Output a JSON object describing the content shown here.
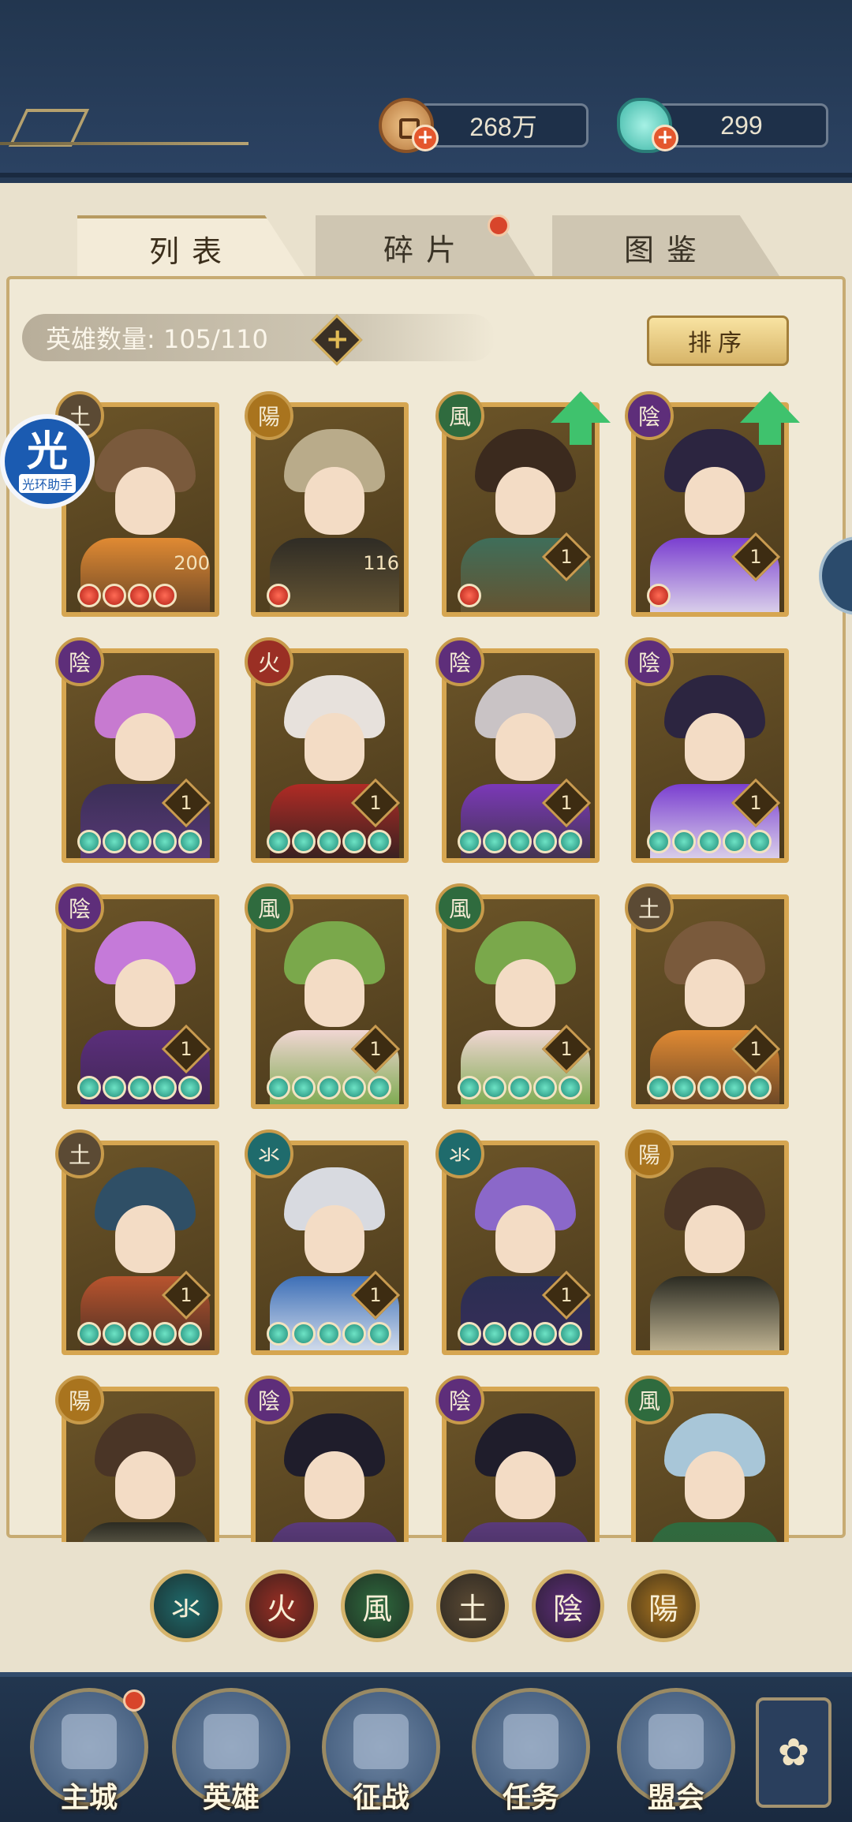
{
  "currency": {
    "coins": "268万",
    "gems": "299"
  },
  "tabs": [
    {
      "label": "列表",
      "active": true
    },
    {
      "label": "碎片",
      "active": false,
      "badge": true
    },
    {
      "label": "图鉴",
      "active": false
    }
  ],
  "hero_count": {
    "label": "英雄数量: 105/110"
  },
  "sort_button": "排序",
  "assist_badge": {
    "main": "光",
    "sub": "光环助手"
  },
  "elements": {
    "water": {
      "glyph": "氺",
      "color": "#1f6b6c"
    },
    "fire": {
      "glyph": "火",
      "color": "#9a2f24"
    },
    "wind": {
      "glyph": "風",
      "color": "#2f6b3e"
    },
    "earth": {
      "glyph": "土",
      "color": "#5b4a34"
    },
    "yin": {
      "glyph": "陰",
      "color": "#5e2e7a"
    },
    "yang": {
      "glyph": "陽",
      "color": "#a9741e"
    }
  },
  "heroes": [
    {
      "element": "earth",
      "level": "200",
      "stars": 4,
      "star_type": "red",
      "upgrade": false,
      "palette": [
        "#7a5a3c",
        "#e08a33",
        "#5a3d24"
      ]
    },
    {
      "element": "yang",
      "level": "116",
      "stars": 1,
      "star_type": "red",
      "upgrade": false,
      "palette": [
        "#b9ab8a",
        "#2f2c25",
        "#6c5a35"
      ]
    },
    {
      "element": "wind",
      "level": "1",
      "stars": 1,
      "star_type": "red",
      "upgrade": true,
      "palette": [
        "#3b2a1e",
        "#3f6e5a",
        "#6b4f2a"
      ]
    },
    {
      "element": "yin",
      "level": "1",
      "stars": 1,
      "star_type": "red",
      "upgrade": true,
      "palette": [
        "#2c2540",
        "#7a3fd0",
        "#e8e6ee"
      ]
    },
    {
      "element": "yin",
      "level": "1",
      "stars": 5,
      "star_type": "green",
      "upgrade": false,
      "palette": [
        "#c77ad0",
        "#3b2f57",
        "#5c3a7a"
      ]
    },
    {
      "element": "fire",
      "level": "1",
      "stars": 5,
      "star_type": "green",
      "upgrade": false,
      "palette": [
        "#e7e1dc",
        "#b02b25",
        "#262020"
      ]
    },
    {
      "element": "yin",
      "level": "1",
      "stars": 5,
      "star_type": "green",
      "upgrade": false,
      "palette": [
        "#c9c3c5",
        "#7b39b8",
        "#3a3340"
      ]
    },
    {
      "element": "yin",
      "level": "1",
      "stars": 5,
      "star_type": "green",
      "upgrade": false,
      "palette": [
        "#2c2540",
        "#7a3fd0",
        "#e8e6ee"
      ]
    },
    {
      "element": "yin",
      "level": "1",
      "stars": 5,
      "star_type": "green",
      "upgrade": false,
      "palette": [
        "#c57ad9",
        "#5b2f7c",
        "#3e2550"
      ]
    },
    {
      "element": "wind",
      "level": "1",
      "stars": 5,
      "star_type": "green",
      "upgrade": false,
      "palette": [
        "#7aa84b",
        "#f1d6d3",
        "#6ca43d"
      ]
    },
    {
      "element": "wind",
      "level": "1",
      "stars": 5,
      "star_type": "green",
      "upgrade": false,
      "palette": [
        "#7aa84b",
        "#f1d6d3",
        "#6ca43d"
      ]
    },
    {
      "element": "earth",
      "level": "1",
      "stars": 5,
      "star_type": "green",
      "upgrade": false,
      "palette": [
        "#7a5a3c",
        "#e08a33",
        "#5a3d24"
      ]
    },
    {
      "element": "earth",
      "level": "1",
      "stars": 5,
      "star_type": "green",
      "upgrade": false,
      "palette": [
        "#2f4f66",
        "#b9542e",
        "#3b2a22"
      ]
    },
    {
      "element": "water",
      "level": "1",
      "stars": 5,
      "star_type": "green",
      "upgrade": false,
      "palette": [
        "#d8dae0",
        "#3d6fb7",
        "#e8ecf3"
      ]
    },
    {
      "element": "water",
      "level": "1",
      "stars": 5,
      "star_type": "green",
      "upgrade": false,
      "palette": [
        "#8b68c9",
        "#2a2f52",
        "#3b2c5a"
      ]
    },
    {
      "element": "yang",
      "level": "",
      "stars": 0,
      "star_type": "green",
      "upgrade": false,
      "palette": [
        "#4a3526",
        "#2b2b22",
        "#d7c9a4"
      ]
    },
    {
      "element": "yang",
      "level": "",
      "stars": 0,
      "star_type": "green",
      "upgrade": false,
      "palette": [
        "#4a3526",
        "#2b2b22",
        "#d7c9a4"
      ]
    },
    {
      "element": "yin",
      "level": "",
      "stars": 0,
      "star_type": "green",
      "upgrade": false,
      "palette": [
        "#1f1d2b",
        "#5a3a7a",
        "#302640"
      ]
    },
    {
      "element": "yin",
      "level": "",
      "stars": 0,
      "star_type": "green",
      "upgrade": false,
      "palette": [
        "#1f1d2b",
        "#5a3a7a",
        "#302640"
      ]
    },
    {
      "element": "wind",
      "level": "",
      "stars": 0,
      "star_type": "green",
      "upgrade": false,
      "palette": [
        "#a8c6d8",
        "#2f6b3e",
        "#3a5a3a"
      ]
    }
  ],
  "filter_order": [
    "water",
    "fire",
    "wind",
    "earth",
    "yin",
    "yang"
  ],
  "bottom_nav": [
    {
      "label": "主城",
      "badge": true,
      "icon": "castle-icon"
    },
    {
      "label": "英雄",
      "badge": false,
      "icon": "hero-portrait-icon"
    },
    {
      "label": "征战",
      "badge": false,
      "icon": "battle-icon"
    },
    {
      "label": "任务",
      "badge": false,
      "icon": "scroll-icon"
    },
    {
      "label": "盟会",
      "badge": false,
      "icon": "guild-icon"
    }
  ],
  "nav_more_icon": "flower-menu-icon"
}
